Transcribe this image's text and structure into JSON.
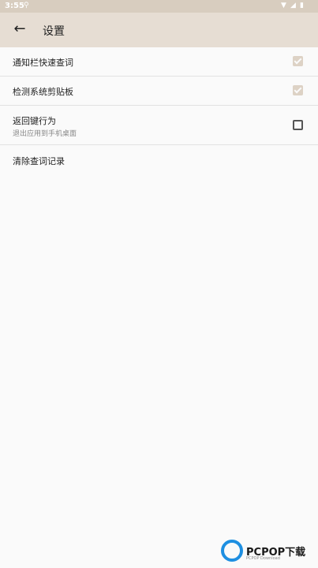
{
  "status_bar": {
    "time": "3:55"
  },
  "app_bar": {
    "title": "设置"
  },
  "settings": [
    {
      "label": "通知栏快速查词",
      "checked": true,
      "enabled": false
    },
    {
      "label": "检测系统剪贴板",
      "checked": true,
      "enabled": false
    },
    {
      "label": "返回键行为",
      "sub": "退出应用到手机桌面",
      "checked": false,
      "enabled": true
    },
    {
      "label": "清除查词记录"
    }
  ],
  "watermark": {
    "brand": "PCPOP下载",
    "small": "PCPOP Download"
  },
  "colors": {
    "app_bar": "#e6ddd3",
    "status_bar": "#d8cdbf",
    "checkbox_disabled": "#ddd2c5",
    "background": "#fafafa"
  }
}
